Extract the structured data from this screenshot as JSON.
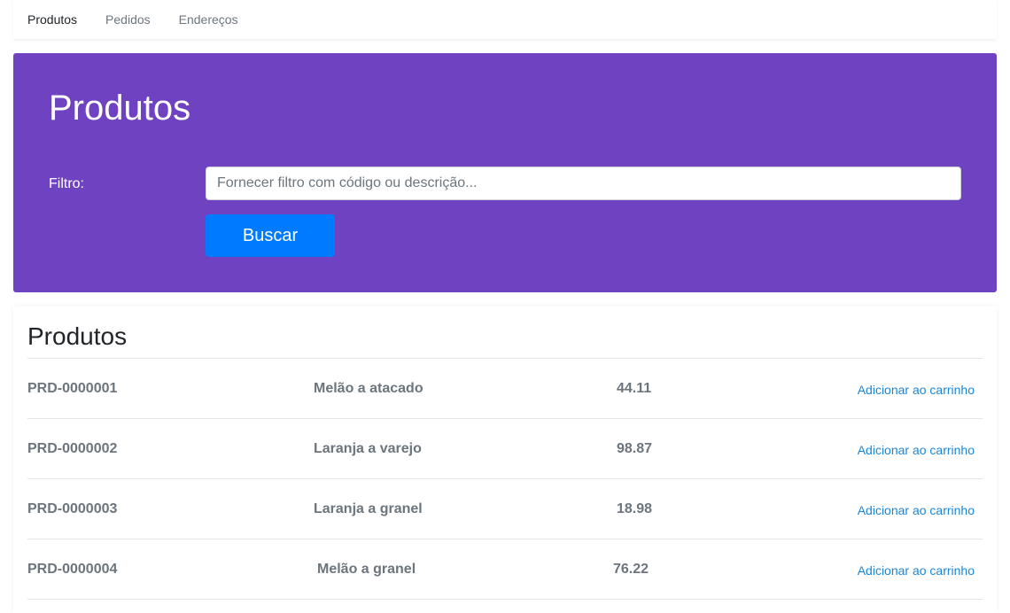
{
  "nav": {
    "items": [
      {
        "label": "Produtos",
        "active": true
      },
      {
        "label": "Pedidos",
        "active": false
      },
      {
        "label": "Endereços",
        "active": false
      }
    ]
  },
  "hero": {
    "title": "Produtos",
    "filter_label": "Filtro:",
    "filter_placeholder": "Fornecer filtro com código ou descrição...",
    "filter_value": "",
    "search_label": "Buscar",
    "background_color": "#6f42c1",
    "button_color": "#007bff"
  },
  "products": {
    "title": "Produtos",
    "rows": [
      {
        "code": "PRD-0000001",
        "description": "Melão a atacado",
        "price": "44.11",
        "action": "Adicionar ao carrinho"
      },
      {
        "code": "PRD-0000002",
        "description": "Laranja a varejo",
        "price": "98.87",
        "action": "Adicionar ao carrinho"
      },
      {
        "code": "PRD-0000003",
        "description": "Laranja a granel",
        "price": "18.98",
        "action": "Adicionar ao carrinho"
      },
      {
        "code": "PRD-0000004",
        "description": "Melão a granel",
        "price": "76.22",
        "action": "Adicionar ao carrinho"
      }
    ]
  }
}
